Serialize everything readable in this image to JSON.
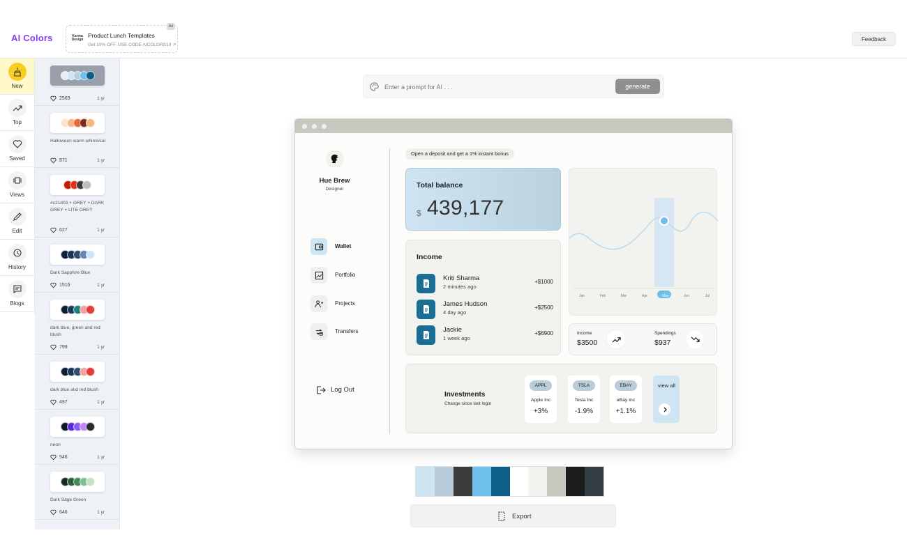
{
  "app": {
    "title": "AI Colors"
  },
  "ad": {
    "brand": "Karma Design",
    "title": "Product Lunch Templates",
    "subtitle": "Get 10% OFF. USE CODE AICOLORS10 ↗",
    "tag": "Ad"
  },
  "header": {
    "feedback_label": "Feedback"
  },
  "nav": {
    "items": [
      {
        "label": "New",
        "icon": "cake-icon",
        "active": true
      },
      {
        "label": "Top",
        "icon": "trending-up-icon"
      },
      {
        "label": "Saved",
        "icon": "heart-icon"
      },
      {
        "label": "Views",
        "icon": "views-icon"
      },
      {
        "label": "Edit",
        "icon": "pencil-icon"
      },
      {
        "label": "History",
        "icon": "history-icon"
      },
      {
        "label": "Blogs",
        "icon": "message-icon"
      }
    ]
  },
  "palettes": [
    {
      "name": "",
      "likes": "2569",
      "age": "1 yr",
      "colors": [
        "#e9eef4",
        "#cfe4f3",
        "#b8d0e0",
        "#70c0ee",
        "#0c5f86"
      ],
      "selected": true
    },
    {
      "name": "Halloween warm whimsical",
      "likes": "871",
      "age": "1 yr",
      "colors": [
        "#f8e3cc",
        "#f7b585",
        "#e86a3a",
        "#7a2e18",
        "#f3b77c"
      ]
    },
    {
      "name": "#c21d03 + GREY + DARK GREY + LITE GREY",
      "likes": "627",
      "age": "1 yr",
      "colors": [
        "#c21d03",
        "#e0301e",
        "#3a3a3a",
        "#bdbdbd"
      ]
    },
    {
      "name": "Dark Sapphire Blue",
      "likes": "1516",
      "age": "1 yr",
      "colors": [
        "#0f1f3a",
        "#1c3457",
        "#344c72",
        "#6486b3",
        "#cfe3fa"
      ]
    },
    {
      "name": "dark blue, green and red blush",
      "likes": "799",
      "age": "1 yr",
      "colors": [
        "#0f1f33",
        "#1b3f5e",
        "#1c7f79",
        "#f2a3a0",
        "#e03c3c"
      ]
    },
    {
      "name": "dark blue and red blush",
      "likes": "497",
      "age": "1 yr",
      "colors": [
        "#0f1d33",
        "#1c3558",
        "#344e70",
        "#f3a3a1",
        "#e63a3a"
      ]
    },
    {
      "name": "neon",
      "likes": "546",
      "age": "1 yr",
      "colors": [
        "#101826",
        "#5b2dd6",
        "#8b5cf6",
        "#c084fc",
        "#2a2a2a"
      ]
    },
    {
      "name": "Dark Sage Green",
      "likes": "646",
      "age": "1 yr",
      "colors": [
        "#1a2a22",
        "#2e5e3e",
        "#3f8a55",
        "#7fbf8f",
        "#c5dfc8"
      ]
    }
  ],
  "prompt": {
    "placeholder": "Enter a prompt for AI . . .",
    "button_label": "generate"
  },
  "preview": {
    "profile": {
      "name": "Hue Brew",
      "role": "Designer"
    },
    "menu": [
      {
        "label": "Wallet",
        "icon": "wallet-icon",
        "active": true
      },
      {
        "label": "Portfolio",
        "icon": "portfolio-icon"
      },
      {
        "label": "Projects",
        "icon": "projects-icon"
      },
      {
        "label": "Transfers",
        "icon": "transfers-icon"
      }
    ],
    "logout_label": "Log Out",
    "promo": "Open a deposit and get a 1% instant bonus",
    "balance": {
      "label": "Total balance",
      "currency": "$",
      "amount": "439,177"
    },
    "income": {
      "title": "Income",
      "transactions": [
        {
          "name": "Kriti Sharma",
          "time": "2 minutes ago",
          "amount": "+$1000"
        },
        {
          "name": "James Hudson",
          "time": "4 day ago",
          "amount": "+$2500"
        },
        {
          "name": "Jackie",
          "time": "1 week ago",
          "amount": "+$6900"
        }
      ]
    },
    "chart": {
      "months": [
        "Jan",
        "Feb",
        "Mar",
        "Apr",
        "May",
        "Jun",
        "Jul"
      ],
      "active_month": "May"
    },
    "stats": {
      "income_label": "Income",
      "income_value": "$3500",
      "spendings_label": "Spendings",
      "spendings_value": "$937"
    },
    "investments": {
      "title": "Investments",
      "subtitle": "Change since last login",
      "stocks": [
        {
          "ticker": "APPL",
          "company": "Apple Inc",
          "change": "+3%"
        },
        {
          "ticker": "TSLA",
          "company": "Tesla Inc",
          "change": "-1.9%"
        },
        {
          "ticker": "EBAY",
          "company": "eBay Inc",
          "change": "+1.1%"
        }
      ],
      "view_all": "view all"
    }
  },
  "color_strip": [
    "#cfe4f3",
    "#b8cdd9",
    "#3b3b3b",
    "#70c0ee",
    "#0c5f86",
    "#ffffff",
    "#f2f2ef",
    "#c8c7c0",
    "#1c1c1c",
    "#343e45"
  ],
  "export_label": "Export"
}
